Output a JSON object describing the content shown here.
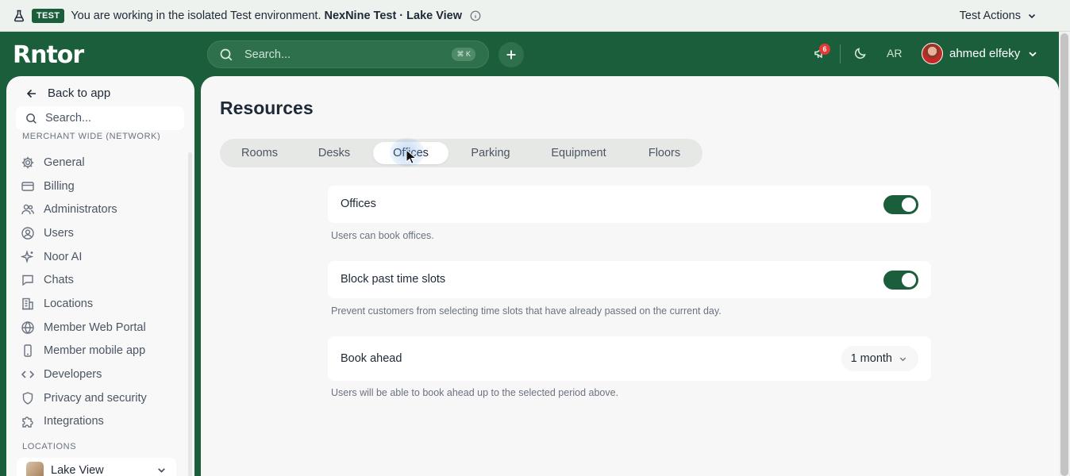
{
  "banner": {
    "badge": "TEST",
    "message": "You are working in the isolated Test environment.",
    "environment": "NexNine Test · Lake View",
    "actions_label": "Test Actions"
  },
  "topnav": {
    "logo": "Rntor",
    "search_placeholder": "Search...",
    "shortcut": "⌘ K",
    "notification_count": "6",
    "language": "AR",
    "user_name": "ahmed elfeky"
  },
  "sidebar": {
    "back_label": "Back to app",
    "search_placeholder": "Search...",
    "section_title": "MERCHANT WIDE (NETWORK)",
    "items": [
      {
        "label": "General",
        "icon": "gear-icon"
      },
      {
        "label": "Billing",
        "icon": "credit-card-icon"
      },
      {
        "label": "Administrators",
        "icon": "users-icon"
      },
      {
        "label": "Users",
        "icon": "user-circle-icon"
      },
      {
        "label": "Noor AI",
        "icon": "sparkles-icon"
      },
      {
        "label": "Chats",
        "icon": "chat-icon"
      },
      {
        "label": "Locations",
        "icon": "building-icon"
      },
      {
        "label": "Member Web Portal",
        "icon": "globe-icon"
      },
      {
        "label": "Member mobile app",
        "icon": "mobile-icon"
      },
      {
        "label": "Developers",
        "icon": "code-icon"
      },
      {
        "label": "Privacy and security",
        "icon": "shield-icon"
      },
      {
        "label": "Integrations",
        "icon": "puzzle-icon"
      }
    ],
    "locations_title": "LOCATIONS",
    "location_selected": "Lake View"
  },
  "main": {
    "title": "Resources",
    "tabs": [
      "Rooms",
      "Desks",
      "Offices",
      "Parking",
      "Equipment",
      "Floors"
    ],
    "active_tab": "Offices",
    "settings": {
      "offices": {
        "label": "Offices",
        "help": "Users can book offices.",
        "enabled": true
      },
      "block_past": {
        "label": "Block past time slots",
        "help": "Prevent customers from selecting time slots that have already passed on the current day.",
        "enabled": true
      },
      "book_ahead": {
        "label": "Book ahead",
        "value": "1 month",
        "help": "Users will be able to book ahead up to the selected period above."
      }
    }
  },
  "colors": {
    "brand": "#1b5e3b",
    "badge": "#e53935"
  }
}
